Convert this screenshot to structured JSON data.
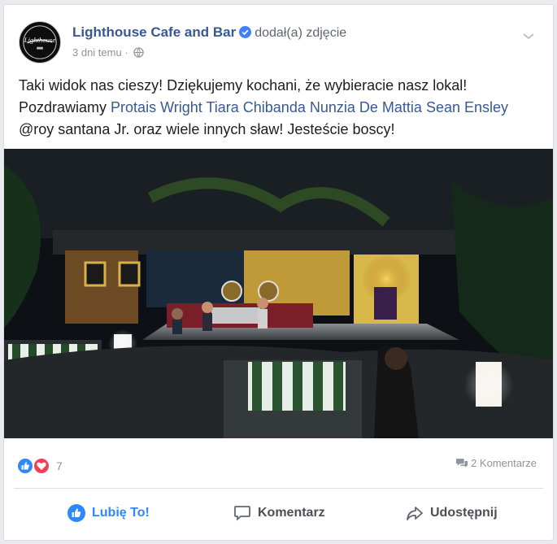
{
  "post": {
    "page_name": "Lighthouse Cafe and Bar",
    "action_text": "dodał(a) zdjęcie",
    "timestamp": "3 dni temu",
    "separator": "·",
    "text_line1": "Taki widok nas cieszy! Dziękujemy kochani, że wybieracie nasz lokal!",
    "text_line2_prefix": "Pozdrawiamy ",
    "tags": [
      "Protais Wright",
      "Tiara Chibanda",
      "Nunzia De Mattia",
      "Sean Ensley"
    ],
    "text_line3": "@roy santana Jr. oraz wiele innych sław! Jesteście boscy!",
    "avatar_logo_text": "Lighthouse"
  },
  "reactions": {
    "count": "7",
    "comments": "2 Komentarze"
  },
  "actions": {
    "like": "Lubię To!",
    "comment": "Komentarz",
    "share": "Udostępnij"
  },
  "colors": {
    "link": "#385898",
    "like_blue": "#2d88ff",
    "love_red": "#f33e58"
  }
}
